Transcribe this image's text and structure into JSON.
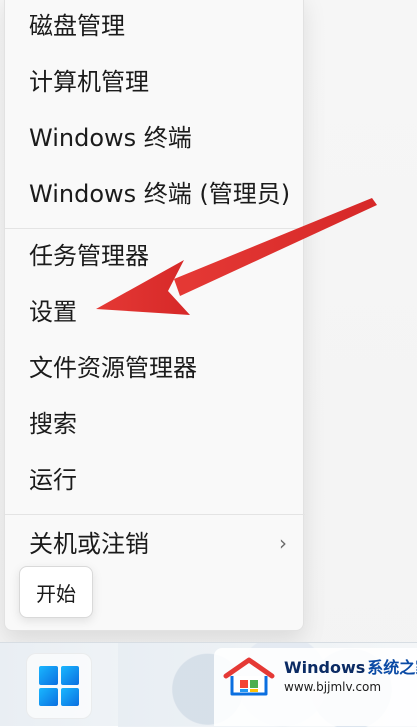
{
  "menu": {
    "items": [
      {
        "label": "磁盘管理",
        "has_submenu": false
      },
      {
        "label": "计算机管理",
        "has_submenu": false
      },
      {
        "label": "Windows 终端",
        "has_submenu": false
      },
      {
        "label": "Windows 终端 (管理员)",
        "has_submenu": false
      },
      {
        "label": "任务管理器",
        "has_submenu": false
      },
      {
        "label": "设置",
        "has_submenu": false
      },
      {
        "label": "文件资源管理器",
        "has_submenu": false
      },
      {
        "label": "搜索",
        "has_submenu": false
      },
      {
        "label": "运行",
        "has_submenu": false
      },
      {
        "label": "关机或注销",
        "has_submenu": true
      }
    ],
    "chevron": "›"
  },
  "tooltip": {
    "label": "开始"
  },
  "taskbar": {
    "start_icon": "windows-logo-icon"
  },
  "watermark": {
    "brand": "Windows",
    "brand_cn": "系统之家",
    "url": "www.bjjmlv.com"
  },
  "annotation": {
    "arrow_color": "#e53935"
  }
}
